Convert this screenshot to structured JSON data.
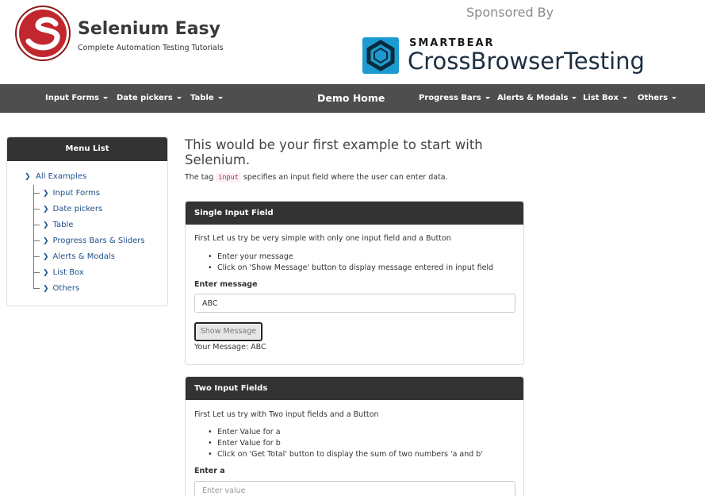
{
  "header": {
    "brand_name": "Selenium Easy",
    "brand_tagline": "Complete Automation Testing Tutorials",
    "sponsored_label": "Sponsored By",
    "sponsor_small": "SMARTBEAR",
    "sponsor_big": "CrossBrowserTesting",
    "logo_icon": "selenium-easy-logo-icon",
    "sponsor_icon": "smartbear-logo-icon"
  },
  "navbar": {
    "left_items": [
      "Input Forms",
      "Date pickers",
      "Table"
    ],
    "home": "Demo Home",
    "right_items": [
      "Progress Bars",
      "Alerts & Modals",
      "List Box",
      "Others"
    ]
  },
  "sidebar": {
    "title": "Menu List",
    "root": "All Examples",
    "items": [
      "Input Forms",
      "Date pickers",
      "Table",
      "Progress Bars & Sliders",
      "Alerts & Modals",
      "List Box",
      "Others"
    ]
  },
  "main": {
    "title": "This would be your first example to start with Selenium.",
    "intro_before": "The tag ",
    "intro_code": "input",
    "intro_after": " specifies an input field where the user can enter data."
  },
  "single_input": {
    "title": "Single Input Field",
    "description": "First Let us try be very simple with only one input field and a Button",
    "bullets": [
      "Enter your message",
      "Click on 'Show Message' button to display message entered in input field"
    ],
    "field_label": "Enter message",
    "field_value": "ABC",
    "button_label": "Show Message",
    "result_label": "Your Message: ",
    "result_value": "ABC"
  },
  "two_inputs": {
    "title": "Two Input Fields",
    "description": "First Let us try with Two input fields and a Button",
    "bullets": [
      "Enter Value for a",
      "Enter Value for b",
      "Click on 'Get Total' button to display the sum of two numbers 'a and b'"
    ],
    "field_a_label": "Enter a",
    "field_a_placeholder": "Enter value"
  },
  "colors": {
    "navbar_bg": "#4e4e4e",
    "panel_head_bg": "#333333",
    "link_blue": "#1f4f8a",
    "logo_red": "#c1272d"
  }
}
